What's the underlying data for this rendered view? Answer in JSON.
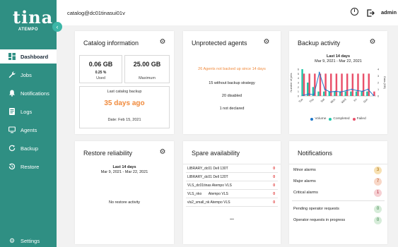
{
  "logo": {
    "text": "tina",
    "sub": "ATEMPO"
  },
  "nav": [
    {
      "label": "Dashboard",
      "icon": "dashboard-icon",
      "active": true
    },
    {
      "label": "Jobs",
      "icon": "wrench-icon"
    },
    {
      "label": "Notifications",
      "icon": "bell-icon"
    },
    {
      "label": "Logs",
      "icon": "logs-icon"
    },
    {
      "label": "Agents",
      "icon": "monitor-icon"
    },
    {
      "label": "Backup",
      "icon": "backup-icon"
    },
    {
      "label": "Restore",
      "icon": "restore-icon"
    },
    {
      "label": "Settings",
      "icon": "gear-icon"
    }
  ],
  "topbar": {
    "path": "catalog@dc01tinasui01v",
    "user": "admin"
  },
  "catalog": {
    "title": "Catalog information",
    "used_value": "0.06 GB",
    "used_pct": "0.25 %",
    "used_label": "Used",
    "max_value": "25.00 GB",
    "max_label": "Maximum",
    "last_label": "Last catalog backup",
    "last_ago": "35 days ago",
    "last_date": "Date: Feb 15, 2021"
  },
  "unprotected": {
    "title": "Unprotected agents",
    "alert": "26 Agents not backed up since 14 days",
    "line1": "15 without backup strategy",
    "line2": "20 disabled",
    "line3": "1 not declared"
  },
  "backup_activity": {
    "title": "Backup activity",
    "range_title": "Last 14 days",
    "range": "Mar 9, 2021 - Mar 22, 2021",
    "ylabel": "Number of jobs",
    "y2label": "Data (GB)",
    "legend": [
      "Volume",
      "Completed",
      "Failed"
    ]
  },
  "chart_data": {
    "type": "bar",
    "title": "Last 14 days",
    "subtitle": "Mar 9, 2021 - Mar 22, 2021",
    "categories": [
      "Tue",
      "Thu",
      "Sat",
      "Mon",
      "Wed",
      "Fri",
      "Sun"
    ],
    "ylabel": "Number of jobs",
    "y2label": "Data (GB)",
    "ylim": [
      0,
      6
    ],
    "y2lim": [
      0,
      4
    ],
    "yticks": [
      "0",
      "1",
      "2",
      "3",
      "4",
      "5",
      "6"
    ],
    "y2ticks": [
      "0",
      "1",
      "2",
      "3",
      "4"
    ],
    "series": [
      {
        "name": "Volume",
        "type": "line",
        "color": "#1f77c9",
        "values": [
          0.1,
          0.3,
          0.2,
          3.5,
          1.0,
          0.6,
          0.7,
          0.6,
          0.8,
          1.0,
          0.8,
          0.7,
          1.0,
          0.1
        ]
      },
      {
        "name": "Completed",
        "type": "bar",
        "color": "#21c7a8",
        "values": [
          6,
          3,
          2,
          1,
          1,
          1,
          1,
          1,
          1,
          1,
          1,
          1,
          1,
          0
        ]
      },
      {
        "name": "Failed",
        "type": "bar",
        "color": "#e9506a",
        "values": [
          5,
          5,
          5,
          5,
          5,
          5,
          5,
          5,
          5,
          5,
          5,
          5,
          5,
          1
        ]
      }
    ],
    "legend": "bottom",
    "grid": false
  },
  "restore": {
    "title": "Restore reliability",
    "range_title": "Last 14 days",
    "range": "Mar 9, 2021 - Mar 22, 2021",
    "empty": "No restore activity"
  },
  "spare": {
    "title": "Spare availability",
    "rows": [
      {
        "name": "LIBRARY_dc01 Dell 130T",
        "count": "0"
      },
      {
        "name": "LIBRARY_dc01 Dell 120T",
        "count": "0"
      },
      {
        "name": "VLS_dc01tinas Atempo VLS",
        "count": "0"
      },
      {
        "name": "VLS_nko       Atempo VLS",
        "count": "0"
      },
      {
        "name": "vls2_small_nk Atempo VLS",
        "count": "0"
      }
    ],
    "more": "..."
  },
  "notifications": {
    "title": "Notifications",
    "alarms": [
      {
        "label": "Minor alarms",
        "count": "3",
        "bg": "#f7e0b2",
        "fg": "#a46b00"
      },
      {
        "label": "Major alarms",
        "count": "7",
        "bg": "#f8d7c7",
        "fg": "#b2481b"
      },
      {
        "label": "Critical alarms",
        "count": "1",
        "bg": "#f6d0d3",
        "fg": "#b0283a"
      }
    ],
    "requests": [
      {
        "label": "Pending operator requests",
        "count": "0",
        "bg": "#d6ecd9",
        "fg": "#2f7a3d"
      },
      {
        "label": "Operator requests in progress",
        "count": "0",
        "bg": "#d6ecd9",
        "fg": "#2f7a3d"
      }
    ]
  }
}
